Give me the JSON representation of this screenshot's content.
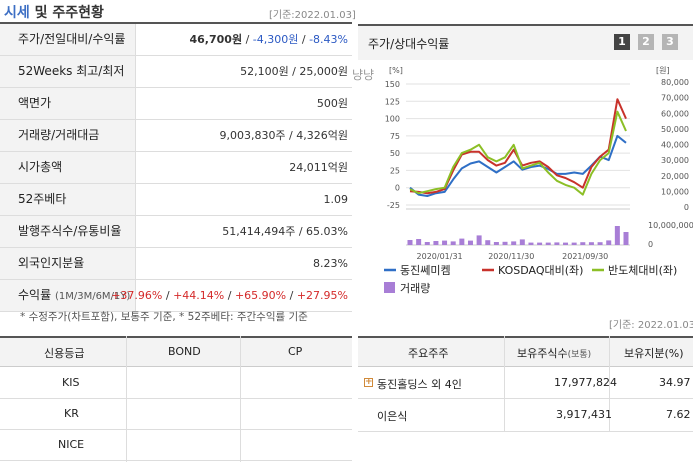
{
  "header": {
    "title_highlight": "시세",
    "title_rest": "및 주주현황",
    "base_date": "[기준:2022.01.03]"
  },
  "market_table": {
    "rows": [
      {
        "label": "주가/전일대비/수익률",
        "price": "46,700원",
        "sep1": " / ",
        "change": "-4,300원",
        "sep2": " / ",
        "rate": "-8.43%"
      },
      {
        "label": "52Weeks 최고/최저",
        "value": "52,100원 / 25,000원"
      },
      {
        "label": "액면가",
        "value": "500원"
      },
      {
        "label": "거래량/거래대금",
        "value": "9,003,830주 / 4,326억원"
      },
      {
        "label": "시가총액",
        "value": "24,011억원"
      },
      {
        "label": "52주베타",
        "value": "1.09"
      },
      {
        "label": "발행주식수/유통비율",
        "value": "51,414,494주 / 65.03%"
      },
      {
        "label": "외국인지분율",
        "value": "8.23%"
      },
      {
        "label": "수익률",
        "label_small": "(1M/3M/6M/1Y)",
        "v1": "+37.96%",
        "v2": "+44.14%",
        "v3": "+65.90%",
        "v4": "+27.95%",
        "sep": " / "
      }
    ],
    "note": "* 수정주가(차트포함), 보통주 기준, * 52주베타: 주간수익률 기준",
    "base_date_2": "[기준: 2022.01.03]"
  },
  "chart_panel": {
    "title": "주가/상대수익률",
    "pages": [
      "1",
      "2",
      "3"
    ],
    "active_page": 0,
    "overlay_text": "냥냥",
    "unit_left": "[%]",
    "unit_right": "[원]",
    "unit_volume_right": "10,000,000"
  },
  "chart_data": {
    "type": "line",
    "x_ticks": [
      "2020/01/31",
      "2020/11/30",
      "2021/09/30"
    ],
    "y_left_ticks": [
      150,
      125,
      100,
      75,
      50,
      25,
      0,
      -25
    ],
    "y_left_range": [
      -25,
      150
    ],
    "y_right_ticks": [
      "80,000",
      "70,000",
      "60,000",
      "50,000",
      "40,000",
      "30,000",
      "20,000",
      "10,000",
      "0"
    ],
    "y_right_range": [
      0,
      80000
    ],
    "volume_right_ticks": [
      "10,000,000",
      "0"
    ],
    "volume_range": [
      0,
      10000000
    ],
    "colors": {
      "stock": "#2f6fc6",
      "kosdaq": "#c8322b",
      "semi": "#8cbf26",
      "volume": "#a87ed6"
    },
    "series": [
      {
        "name": "동진쎄미켐",
        "key": "stock",
        "values": [
          0,
          -10,
          -12,
          -8,
          -6,
          12,
          28,
          35,
          38,
          30,
          22,
          30,
          38,
          26,
          30,
          32,
          27,
          20,
          20,
          22,
          20,
          32,
          45,
          40,
          75,
          65
        ]
      },
      {
        "name": "KOSDAQ대비(좌)",
        "key": "kosdaq",
        "values": [
          -5,
          -6,
          -8,
          -6,
          -2,
          25,
          48,
          52,
          52,
          40,
          32,
          36,
          55,
          32,
          36,
          38,
          30,
          18,
          14,
          8,
          0,
          30,
          45,
          55,
          128,
          100
        ]
      },
      {
        "name": "반도체대비(좌)",
        "key": "semi",
        "values": [
          -2,
          -8,
          -5,
          -2,
          0,
          30,
          50,
          55,
          62,
          44,
          38,
          44,
          62,
          28,
          32,
          36,
          22,
          10,
          4,
          0,
          -10,
          20,
          40,
          50,
          110,
          82
        ]
      },
      {
        "name": "거래량",
        "key": "volume",
        "values": [
          2500000,
          3000000,
          1500000,
          2000000,
          2200000,
          1800000,
          3200000,
          2200000,
          4800000,
          2400000,
          1500000,
          1600000,
          1800000,
          2800000,
          1200000,
          1200000,
          1200000,
          1300000,
          1200000,
          1200000,
          1400000,
          1400000,
          1400000,
          2300000,
          9500000,
          6500000
        ]
      }
    ],
    "legend": [
      {
        "label": "동진쎄미켐",
        "key": "stock",
        "kind": "line"
      },
      {
        "label": "KOSDAQ대비(좌)",
        "key": "kosdaq",
        "kind": "line"
      },
      {
        "label": "반도체대비(좌)",
        "key": "semi",
        "kind": "line"
      },
      {
        "label": "거래량",
        "key": "volume",
        "kind": "box"
      }
    ]
  },
  "credit_table": {
    "headers": [
      "신용등급",
      "BOND",
      "CP"
    ],
    "rows": [
      [
        "KIS",
        "",
        ""
      ],
      [
        "KR",
        "",
        ""
      ],
      [
        "NICE",
        "",
        ""
      ]
    ]
  },
  "holder_table": {
    "headers": [
      "주요주주",
      "보유주식수",
      "(보통)",
      "보유지분(%)"
    ],
    "rows": [
      {
        "name": "동진홀딩스 외 4인",
        "shares": "17,977,824",
        "pct": "34.97",
        "expand": true
      },
      {
        "name": "이은식",
        "shares": "3,917,431",
        "pct": "7.62",
        "expand": false
      }
    ]
  }
}
